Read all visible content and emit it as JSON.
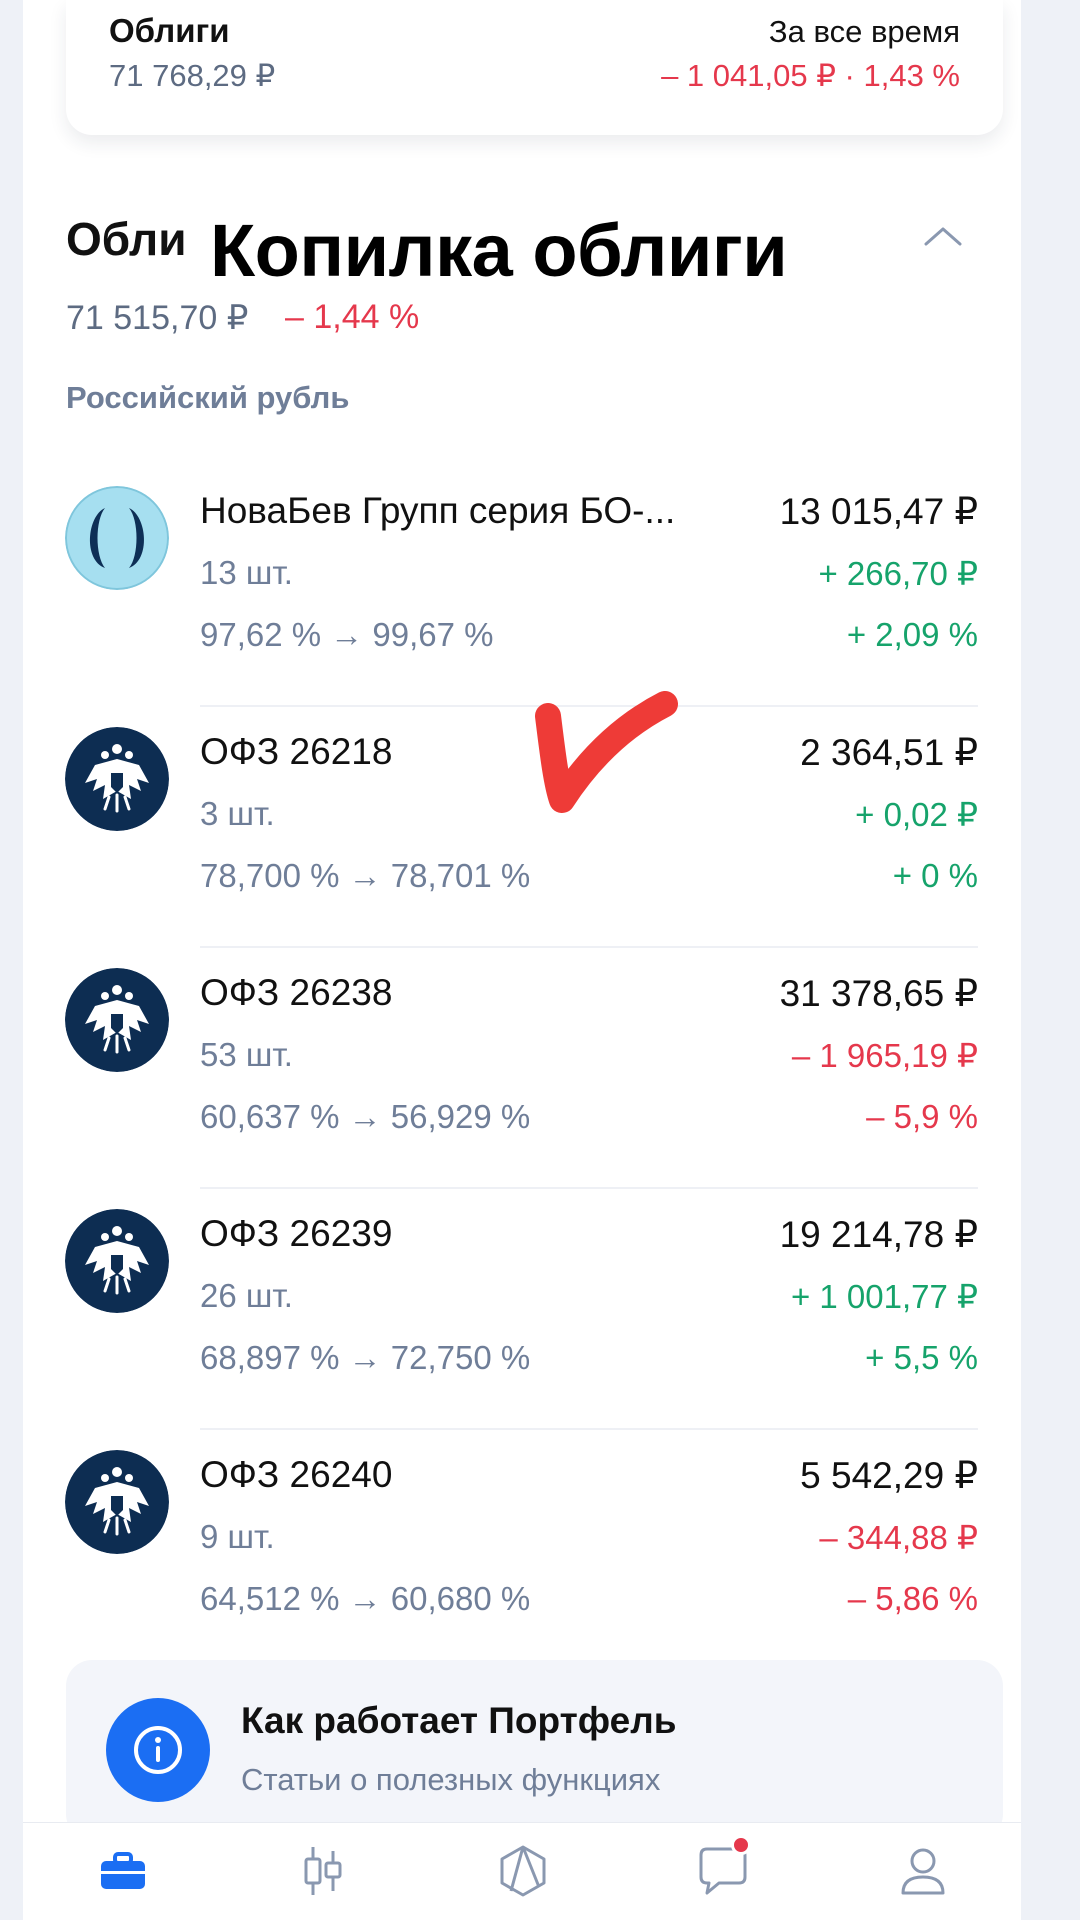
{
  "summary": {
    "title": "Облиги",
    "value": "71 768,29 ₽",
    "period": "За все время",
    "change": "– 1 041,05 ₽ · 1,43 %"
  },
  "section": {
    "header_partial": "Обли",
    "overlay_title": "Копилка облиги",
    "value": "71 515,70 ₽",
    "change": "– 1,44 %",
    "currency_label": "Российский рубль"
  },
  "holdings": [
    {
      "name": "НоваБев Групп серия БО-...",
      "qty": "13 шт.",
      "price_range": "97,62 % → 99,67 %",
      "total": "13 015,47 ₽",
      "change_abs": "+ 266,70 ₽",
      "change_pct": "+ 2,09 %",
      "trend": "positive",
      "logo": "novabev-logo-icon"
    },
    {
      "name": "ОФЗ 26218",
      "qty": "3 шт.",
      "price_range": "78,700 % → 78,701 %",
      "total": "2 364,51 ₽",
      "change_abs": "+ 0,02 ₽",
      "change_pct": "+ 0 %",
      "trend": "positive",
      "logo": "russia-emblem-icon"
    },
    {
      "name": "ОФЗ 26238",
      "qty": "53 шт.",
      "price_range": "60,637 % → 56,929 %",
      "total": "31 378,65 ₽",
      "change_abs": "– 1 965,19 ₽",
      "change_pct": "– 5,9 %",
      "trend": "negative",
      "logo": "russia-emblem-icon"
    },
    {
      "name": "ОФЗ 26239",
      "qty": "26 шт.",
      "price_range": "68,897 % → 72,750 %",
      "total": "19 214,78 ₽",
      "change_abs": "+ 1 001,77 ₽",
      "change_pct": "+ 5,5 %",
      "trend": "positive",
      "logo": "russia-emblem-icon"
    },
    {
      "name": "ОФЗ 26240",
      "qty": "9 шт.",
      "price_range": "64,512 % → 60,680 %",
      "total": "5 542,29 ₽",
      "change_abs": "– 344,88 ₽",
      "change_pct": "– 5,86 %",
      "trend": "negative",
      "logo": "russia-emblem-icon"
    }
  ],
  "info_card": {
    "title": "Как работает Портфель",
    "subtitle": "Статьи о полезных функциях",
    "icon": "info-icon"
  },
  "tabbar": {
    "items": [
      "portfolio-icon",
      "candles-icon",
      "hexagon-icon",
      "chat-icon",
      "profile-icon"
    ],
    "active": "portfolio-icon"
  },
  "colors": {
    "positive": "#16a36b",
    "negative": "#e5384c",
    "accent": "#1b6ef3",
    "muted": "#6f7e98",
    "emblem_bg": "#0d2d52",
    "novabev_bg": "#a6dff0"
  }
}
